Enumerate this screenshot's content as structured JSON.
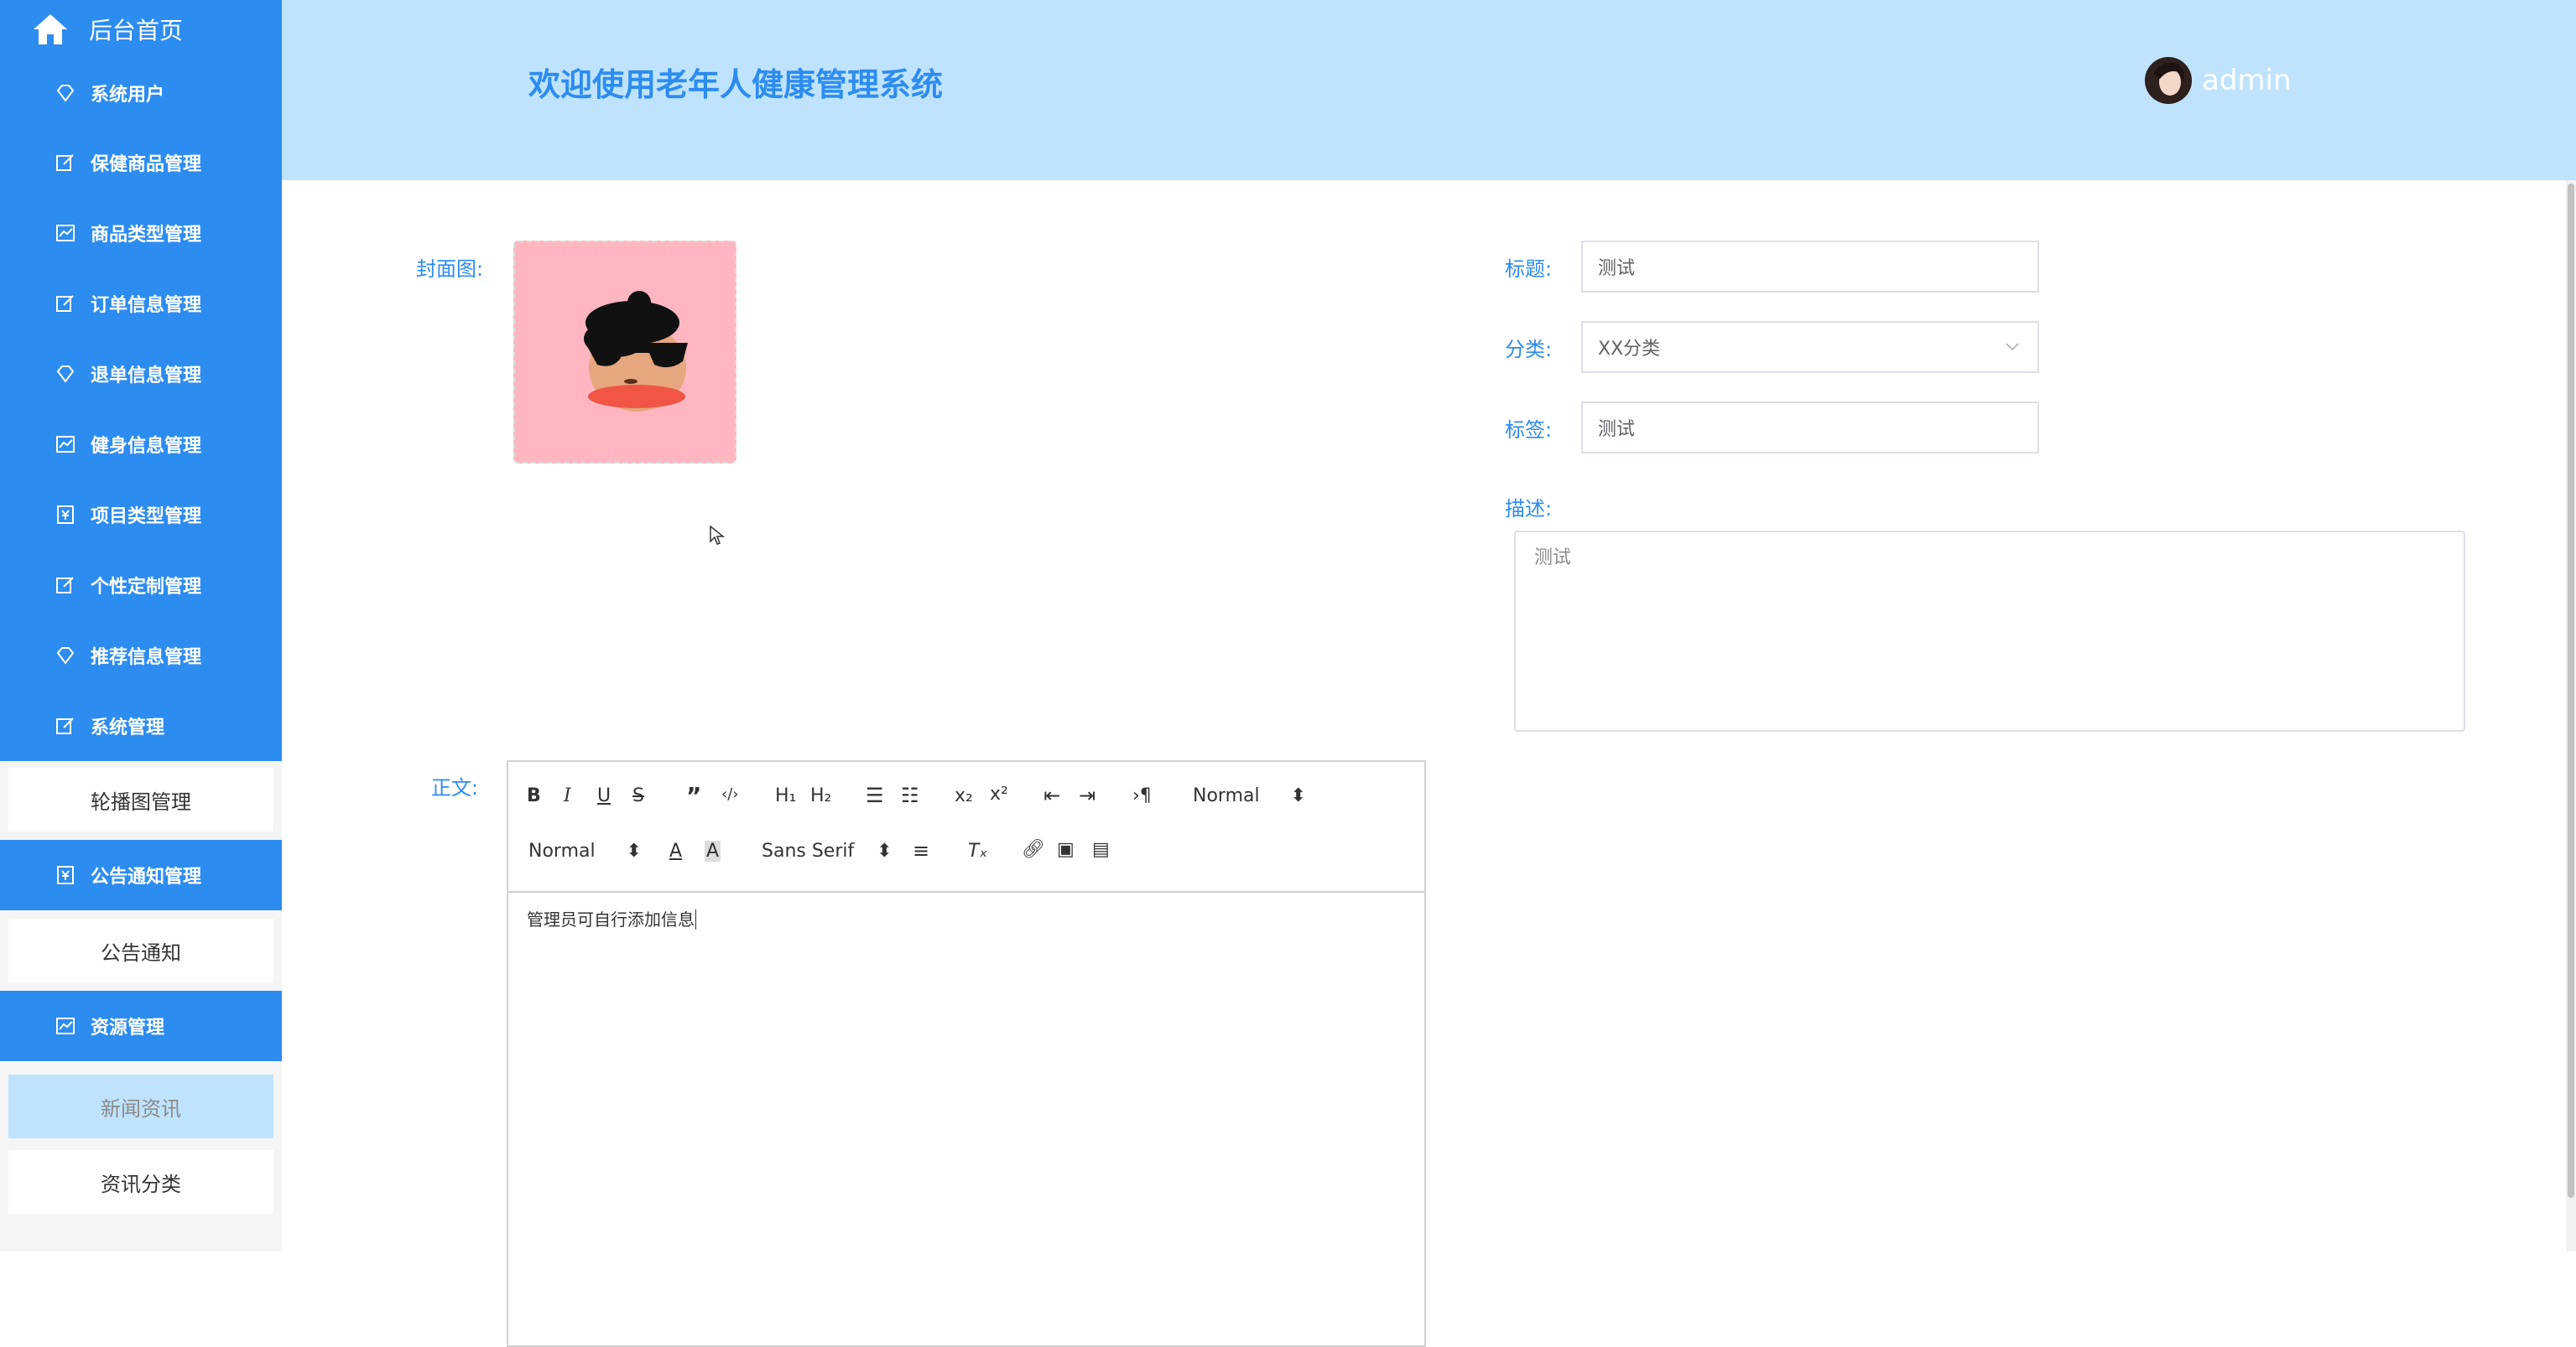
{
  "sidebar": {
    "home_label": "后台首页",
    "menus": [
      {
        "label": "系统用户",
        "icon": "diamond-icon"
      },
      {
        "label": "保健商品管理",
        "icon": "edit-icon"
      },
      {
        "label": "商品类型管理",
        "icon": "chart-icon"
      },
      {
        "label": "订单信息管理",
        "icon": "edit-icon"
      },
      {
        "label": "退单信息管理",
        "icon": "diamond-icon"
      },
      {
        "label": "健身信息管理",
        "icon": "chart-icon"
      },
      {
        "label": "项目类型管理",
        "icon": "yen-icon"
      },
      {
        "label": "个性定制管理",
        "icon": "edit-icon"
      },
      {
        "label": "推荐信息管理",
        "icon": "diamond-icon"
      },
      {
        "label": "系统管理",
        "icon": "edit-icon"
      }
    ],
    "system_sub": [
      "轮播图管理"
    ],
    "notice_menu": "公告通知管理",
    "notice_sub": [
      "公告通知"
    ],
    "resource_menu": "资源管理",
    "resource_sub": [
      "新闻资讯",
      "资讯分类"
    ]
  },
  "header": {
    "title": "欢迎使用老年人健康管理系统",
    "user": "admin"
  },
  "form": {
    "cover_label": "封面图:",
    "title_label": "标题:",
    "title_value": "测试",
    "category_label": "分类:",
    "category_value": "XX分类",
    "tag_label": "标签:",
    "tag_value": "测试",
    "desc_label": "描述:",
    "desc_value": "测试",
    "body_label": "正文:",
    "body_value": "管理员可自行添加信息"
  },
  "editor": {
    "header_select": "Normal",
    "size_select": "Normal",
    "font_select": "Sans Serif"
  },
  "colors": {
    "accent": "#2d8cf0",
    "header_bg": "#bfe3fd",
    "cover_bg": "#ffb6c1"
  }
}
